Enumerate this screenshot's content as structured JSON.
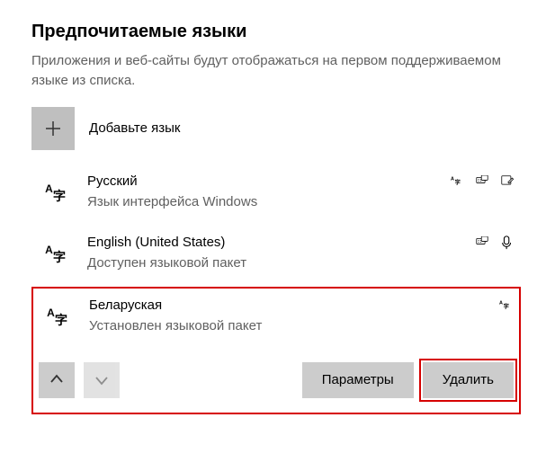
{
  "section": {
    "title": "Предпочитаемые языки",
    "description": "Приложения и веб-сайты будут отображаться на первом поддерживаемом языке из списка.",
    "add_label": "Добавьте язык"
  },
  "languages": [
    {
      "name": "Русский",
      "subtitle": "Язык интерфейса Windows",
      "selected": false,
      "features": {
        "display": true,
        "tts": false,
        "keyboard": true,
        "handwriting": true,
        "speech": false
      }
    },
    {
      "name": "English (United States)",
      "subtitle": "Доступен языковой пакет",
      "selected": false,
      "features": {
        "display": false,
        "tts": false,
        "keyboard": true,
        "handwriting": false,
        "speech": true
      }
    },
    {
      "name": "Беларуская",
      "subtitle": "Установлен языковой пакет",
      "selected": true,
      "features": {
        "display": true,
        "tts": false,
        "keyboard": false,
        "handwriting": false,
        "speech": false
      }
    }
  ],
  "actions": {
    "options": "Параметры",
    "remove": "Удалить"
  },
  "icons": {
    "plus": "plus-icon",
    "lang": "language-icon",
    "display": "display-language-icon",
    "keyboard": "keyboard-icon",
    "handwriting": "handwriting-icon",
    "speech": "speech-icon",
    "up": "arrow-up-icon",
    "down": "arrow-down-icon"
  }
}
